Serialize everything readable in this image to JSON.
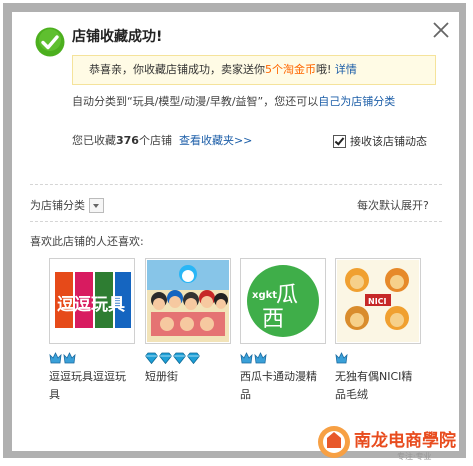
{
  "dialog": {
    "title": "店铺收藏成功!",
    "notice": {
      "prefix": "恭喜亲，你收藏店铺成功，卖家送你",
      "amount": "5个淘金币",
      "suffix": "哦!",
      "link": "详情"
    },
    "category_line": {
      "prefix": "自动分类到“玩具/模型/动漫/早教/益智”，您还可以",
      "link": "自己为店铺分类"
    },
    "collected": {
      "prefix": "您已收藏",
      "count": "376",
      "suffix": "个店铺",
      "link": "查看收藏夹>>"
    },
    "subscribe_label": "接收该店铺动态",
    "subscribe_checked": true,
    "category_select": "为店铺分类",
    "expand_link": "每次默认展开?",
    "also_like_label": "喜欢此店铺的人还喜欢:"
  },
  "shops": [
    {
      "name": "逗逗玩具逗逗玩具",
      "gem_icon": "crown-icon",
      "gem_count": 2,
      "gem_color": "#3aa0d8",
      "thumb_text": "逗逗玩具"
    },
    {
      "name": "短册街",
      "gem_icon": "diamond-icon",
      "gem_count": 4,
      "gem_color": "#1e9fd6",
      "thumb_text": ""
    },
    {
      "name": "西瓜卡通动漫精品",
      "gem_icon": "crown-icon",
      "gem_count": 2,
      "gem_color": "#3aa0d8",
      "thumb_text": "xgkt 西瓜"
    },
    {
      "name": "无独有偶NICI精品毛绒",
      "gem_icon": "crown-icon",
      "gem_count": 1,
      "gem_color": "#3aa0d8",
      "thumb_text": "NICI"
    }
  ],
  "watermark": {
    "brand": "南龙电商學院",
    "tagline": "专注·专业"
  },
  "colors": {
    "accent_orange": "#ff6600",
    "link_blue": "#1c5ea8",
    "check_green": "#4caf1e",
    "notice_bg": "#fffbe5"
  }
}
